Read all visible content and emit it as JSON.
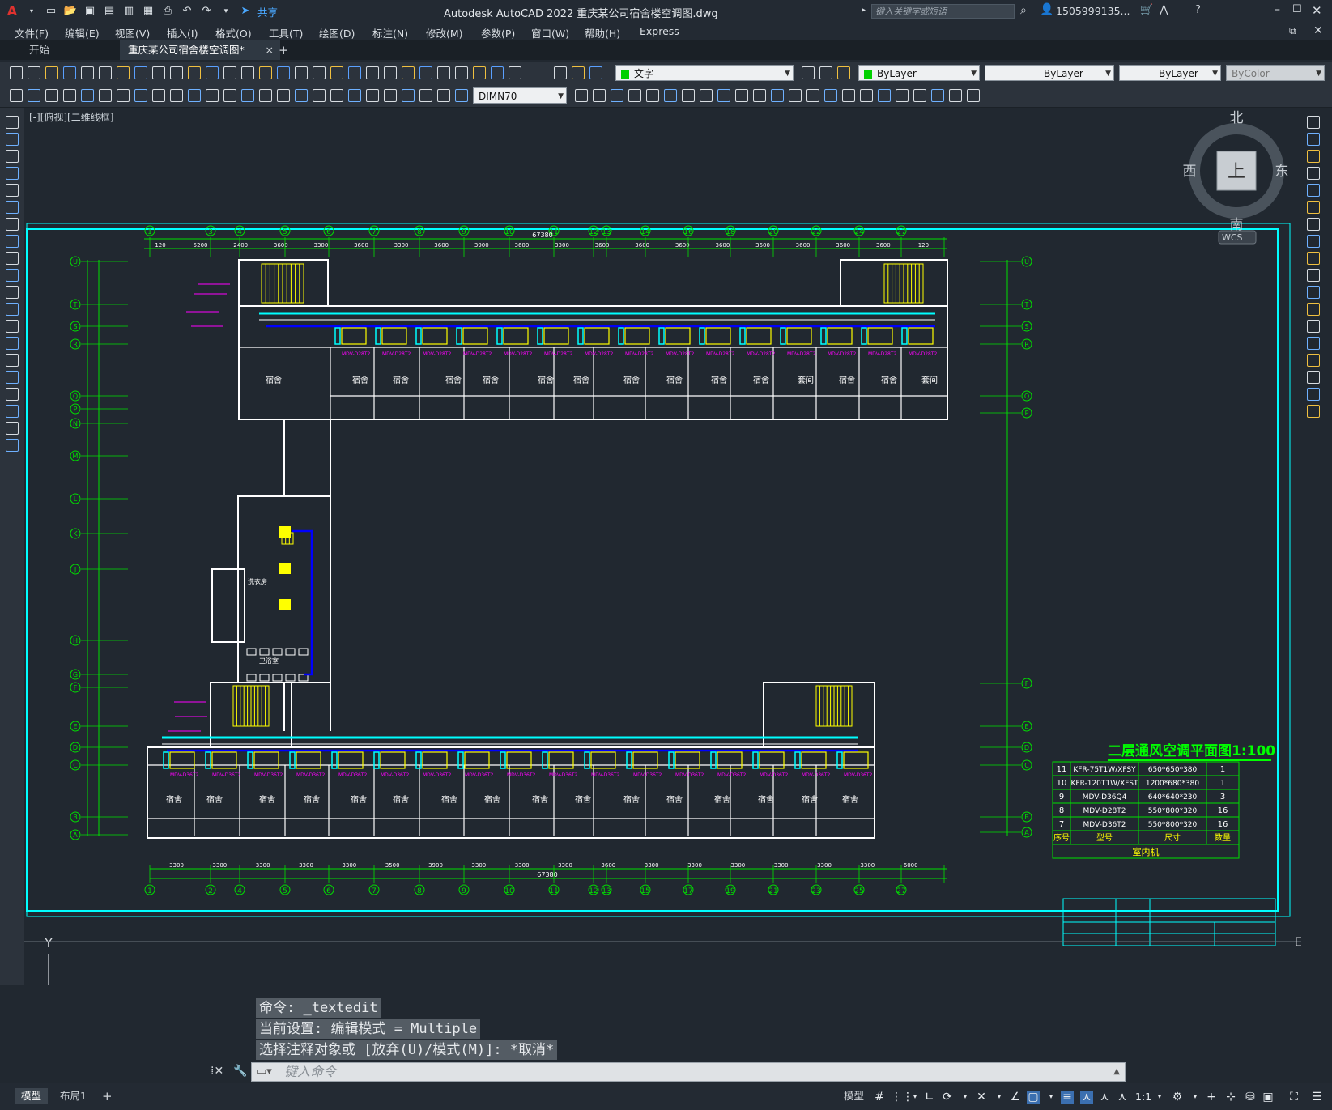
{
  "titlebar": {
    "app_logo": "A",
    "share_label": "共享",
    "title": "Autodesk AutoCAD 2022    重庆某公司宿舍楼空调图.dwg",
    "search_placeholder": "键入关键字或短语",
    "user": "1505999135...",
    "icons": [
      "new-file-icon",
      "open-icon",
      "save-icon",
      "save-as-icon",
      "plot-icon",
      "undo-icon",
      "redo-icon",
      "share-icon",
      "cart-icon",
      "help-icon"
    ]
  },
  "menu": {
    "items": [
      "文件(F)",
      "编辑(E)",
      "视图(V)",
      "插入(I)",
      "格式(O)",
      "工具(T)",
      "绘图(D)",
      "标注(N)",
      "修改(M)",
      "参数(P)",
      "窗口(W)",
      "帮助(H)",
      "Express"
    ]
  },
  "tabs": {
    "start": "开始",
    "document": "重庆某公司宿舍楼空调图*",
    "close": "×",
    "add": "+"
  },
  "toolbar": {
    "layer": "文字",
    "color": "ByLayer",
    "linetype": "ByLayer",
    "lineweight": "ByLayer",
    "plotstyle": "ByColor",
    "dimstyle": "DIMN70"
  },
  "viewport": {
    "label": "[-][俯视][二维线框]",
    "viewcube": {
      "north": "北",
      "south": "南",
      "east": "东",
      "west": "西",
      "top": "上",
      "wcs": "WCS"
    }
  },
  "drawing": {
    "title": "二层通风空调平面图1:100",
    "overall_dim": "67380",
    "column_grid": [
      "1",
      "3",
      "4",
      "5",
      "6",
      "7",
      "8",
      "9",
      "10",
      "11",
      "12",
      "13",
      "14",
      "16",
      "18",
      "20",
      "22",
      "24",
      "27"
    ],
    "column_grid_bottom": [
      "1",
      "2",
      "4",
      "5",
      "6",
      "7",
      "8",
      "9",
      "10",
      "11",
      "12",
      "13",
      "15",
      "17",
      "19",
      "21",
      "23",
      "25",
      "27"
    ],
    "row_grid_top": [
      "U",
      "T",
      "S",
      "R",
      "Q",
      "P",
      "N",
      "M",
      "L",
      "K",
      "J",
      "H",
      "G",
      "F",
      "E",
      "D",
      "C",
      "B",
      "A"
    ],
    "row_grid_right": [
      "U",
      "T",
      "S",
      "R",
      "Q",
      "P",
      "F",
      "E",
      "D",
      "C",
      "B",
      "A"
    ],
    "room_labels_top": [
      "宿舍",
      "宿舍",
      "宿舍",
      "宿舍",
      "宿舍",
      "宿舍",
      "宿舍",
      "宿舍",
      "宿舍",
      "宿舍",
      "宿舍",
      "套间",
      "宿舍",
      "宿舍",
      "套间"
    ],
    "room_labels_bottom": [
      "宿舍",
      "宿舍",
      "宿舍",
      "宿舍",
      "宿舍",
      "宿舍",
      "宿舍",
      "宿舍",
      "宿舍",
      "宿舍",
      "宿舍",
      "宿舍",
      "宿舍",
      "宿舍",
      "宿舍",
      "宿舍",
      "宿舍"
    ],
    "corridor_labels": [
      "洗衣房",
      "卫浴室"
    ],
    "top_dims": [
      "120",
      "5200",
      "2400",
      "3600",
      "3300",
      "3600",
      "3300",
      "3600",
      "3900",
      "3600",
      "3300",
      "3600",
      "3600",
      "3600",
      "3600",
      "3600",
      "3600",
      "3600",
      "3600",
      "120"
    ],
    "bottom_dims": [
      "3300",
      "3300",
      "3300",
      "3300",
      "3300",
      "3500",
      "3900",
      "3300",
      "3300",
      "3300",
      "3600",
      "3300",
      "3300",
      "3300",
      "3300",
      "3300",
      "3300",
      "6000"
    ],
    "schedule": {
      "rows": [
        {
          "no": "11",
          "model": "KFR-75T1W/XFSY",
          "size": "650*650*380",
          "qty": "1"
        },
        {
          "no": "10",
          "model": "KFR-120T1W/XFST",
          "size": "1200*680*380",
          "qty": "1"
        },
        {
          "no": "9",
          "model": "MDV-D36Q4",
          "size": "640*640*230",
          "qty": "3"
        },
        {
          "no": "8",
          "model": "MDV-D28T2",
          "size": "550*800*320",
          "qty": "16"
        },
        {
          "no": "7",
          "model": "MDV-D36T2",
          "size": "550*800*320",
          "qty": "16"
        }
      ],
      "header": {
        "no": "序号",
        "model": "型号",
        "size": "尺寸",
        "qty": "数量"
      },
      "footer": "室内机"
    }
  },
  "command": {
    "history": [
      "命令: _textedit",
      "当前设置: 编辑模式 = Multiple",
      "选择注释对象或 [放弃(U)/模式(M)]: *取消*"
    ],
    "placeholder": "键入命令"
  },
  "status": {
    "tabs": [
      "模型",
      "布局1",
      "+"
    ],
    "model_label": "模型",
    "scale": "1:1"
  },
  "colors": {
    "background": "#212830",
    "grid": "#00e000",
    "wall": "#ffffff",
    "duct": "#00ffff",
    "pipe": "#0000ff",
    "unit": "#ffff00",
    "label": "#ff00ff"
  }
}
